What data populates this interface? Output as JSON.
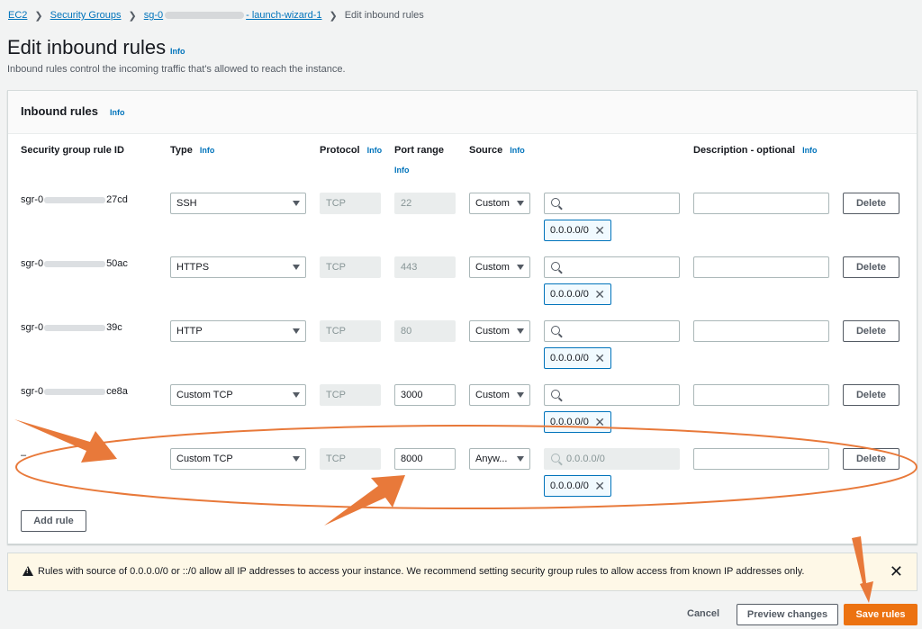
{
  "breadcrumb": {
    "ec2": "EC2",
    "security_groups": "Security Groups",
    "sg_prefix": "sg-0",
    "sg_suffix": "- launch-wizard-1",
    "current": "Edit inbound rules"
  },
  "page": {
    "title": "Edit inbound rules",
    "info": "Info",
    "description": "Inbound rules control the incoming traffic that's allowed to reach the instance."
  },
  "panel": {
    "title": "Inbound rules",
    "info": "Info",
    "columns": {
      "rule_id": "Security group rule ID",
      "type": "Type",
      "type_info": "Info",
      "protocol": "Protocol",
      "protocol_info": "Info",
      "port_range": "Port range",
      "port_info": "Info",
      "source": "Source",
      "source_info": "Info",
      "description": "Description - optional",
      "description_info": "Info"
    },
    "rules": [
      {
        "id_prefix": "sgr-0",
        "id_suffix": "27cd",
        "type": "SSH",
        "protocol": "TCP",
        "port": "22",
        "source": "Custom",
        "token": "0.0.0.0/0",
        "delete": "Delete"
      },
      {
        "id_prefix": "sgr-0",
        "id_suffix": "50ac",
        "type": "HTTPS",
        "protocol": "TCP",
        "port": "443",
        "source": "Custom",
        "token": "0.0.0.0/0",
        "delete": "Delete"
      },
      {
        "id_prefix": "sgr-0",
        "id_suffix": "39c",
        "type": "HTTP",
        "protocol": "TCP",
        "port": "80",
        "source": "Custom",
        "token": "0.0.0.0/0",
        "delete": "Delete"
      },
      {
        "id_prefix": "sgr-0",
        "id_suffix": "ce8a",
        "type": "Custom TCP",
        "protocol": "TCP",
        "port": "3000",
        "source": "Custom",
        "token": "0.0.0.0/0",
        "delete": "Delete"
      },
      {
        "id_text": "–",
        "type": "Custom TCP",
        "protocol": "TCP",
        "port": "8000",
        "source": "Anyw...",
        "search_placeholder": "0.0.0.0/0",
        "token": "0.0.0.0/0",
        "delete": "Delete"
      }
    ],
    "add_rule": "Add rule"
  },
  "alert": {
    "text": "Rules with source of 0.0.0.0/0 or ::/0 allow all IP addresses to access your instance. We recommend setting security group rules to allow access from known IP addresses only.",
    "close_icon": "close-icon"
  },
  "footer": {
    "cancel": "Cancel",
    "preview": "Preview changes",
    "save": "Save rules"
  },
  "annotation_color": "#e8793a"
}
